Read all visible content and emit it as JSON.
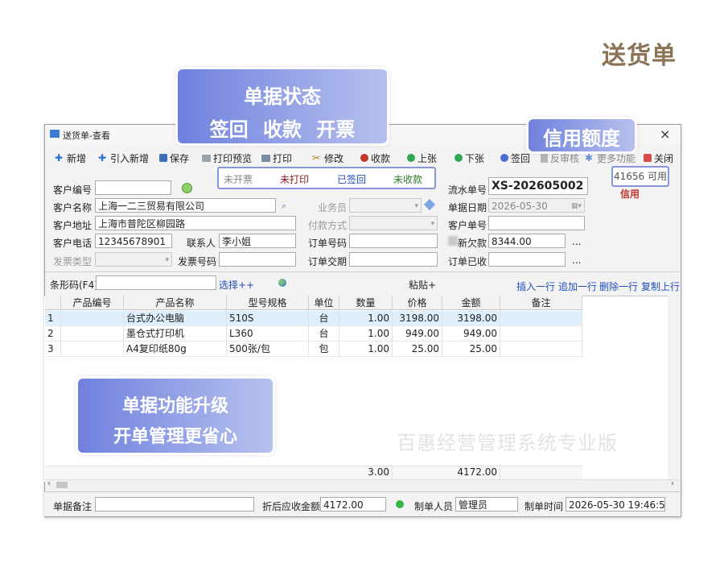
{
  "page_title": "送货单",
  "window": {
    "title": "送货单-查看",
    "close": "×"
  },
  "toolbar": {
    "add": "新增",
    "import_add": "引入新增",
    "save": "保存",
    "print_preview": "打印预览",
    "print": "打印",
    "edit": "修改",
    "receive": "收款",
    "prev": "上张",
    "next": "下张",
    "sign": "签回",
    "unaudit": "反审核",
    "more": "更多功能",
    "close": "关闭"
  },
  "status": {
    "invoice": "未开票",
    "print": "未打印",
    "sign": "已签回",
    "payment": "未收款"
  },
  "credit": {
    "text": "41656 可用",
    "label": "信用"
  },
  "callouts": {
    "status": [
      "单据状态",
      "签回 收款 开票"
    ],
    "credit": "信用额度",
    "upgrade": [
      "单据功能升级",
      "开单管理更省心"
    ]
  },
  "form": {
    "customer_code_label": "客户编号",
    "customer_name_label": "客户名称",
    "customer_name": "上海一二三贸易有限公司",
    "customer_addr_label": "客户地址",
    "customer_addr": "上海市普陀区柳园路",
    "customer_phone_label": "客户电话",
    "customer_phone": "12345678901",
    "contact_label": "联系人",
    "contact": "李小姐",
    "invoice_type_label": "发票类型",
    "invoice_no_label": "发票号码",
    "salesman_label": "业务员",
    "pay_method_label": "付款方式",
    "order_no_label": "订单号码",
    "order_date_label": "订单交期",
    "serial_label": "流水单号",
    "serial": "XS-202605002",
    "doc_date_label": "单据日期",
    "doc_date": "2026-05-30",
    "customer_doc_label": "客户单号",
    "new_debt_label": "新欠款",
    "new_debt": "8344.00",
    "order_received_label": "订单已收",
    "ellipsis": "..."
  },
  "barcode": {
    "label": "条形码(F4)",
    "select": "选择++",
    "paste": "粘贴+"
  },
  "row_actions": {
    "insert": "插入一行",
    "append": "追加一行",
    "delete": "删除一行",
    "copy": "复制上行"
  },
  "table": {
    "headers": [
      "产品编号",
      "产品名称",
      "型号规格",
      "单位",
      "数量",
      "价格",
      "金额",
      "备注"
    ],
    "rows": [
      {
        "no": "1",
        "code": "",
        "name": "台式办公电脑",
        "spec": "510S",
        "unit": "台",
        "qty": "1.00",
        "price": "3198.00",
        "amount": "3198.00",
        "note": ""
      },
      {
        "no": "2",
        "code": "",
        "name": "墨仓式打印机",
        "spec": "L360",
        "unit": "台",
        "qty": "1.00",
        "price": "949.00",
        "amount": "949.00",
        "note": ""
      },
      {
        "no": "3",
        "code": "",
        "name": "A4复印纸80g",
        "spec": "500张/包",
        "unit": "包",
        "qty": "1.00",
        "price": "25.00",
        "amount": "25.00",
        "note": ""
      }
    ],
    "total_qty": "3.00",
    "total_amount": "4172.00"
  },
  "watermark": "百惠经营管理系统专业版",
  "bottom": {
    "note_label": "单据备注",
    "discount_label": "折后应收金额",
    "discount_value": "4172.00",
    "maker_label": "制单人员",
    "maker": "管理员",
    "time_label": "制单时间",
    "time": "2026-05-30 19:46:57"
  }
}
